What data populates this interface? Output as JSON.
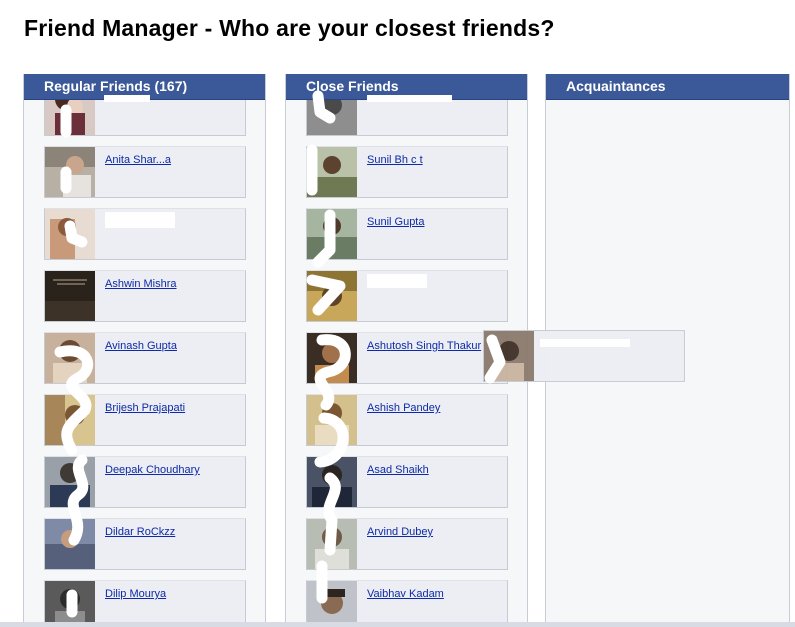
{
  "page": {
    "title": "Friend Manager - Who are your closest friends?"
  },
  "columns": {
    "regular": {
      "header": "Regular Friends (167)",
      "friends": [
        {
          "name": "",
          "photo": "person-photo"
        },
        {
          "name": "Anita Shar...a",
          "photo": "person-photo"
        },
        {
          "name": "",
          "photo": "person-photo"
        },
        {
          "name": "Ashwin Mishra",
          "photo": "dark-text-photo"
        },
        {
          "name": "Avinash Gupta",
          "photo": "person-photo"
        },
        {
          "name": "Brijesh Prajapati",
          "photo": "person-photo"
        },
        {
          "name": "Deepak Choudhary",
          "photo": "person-photo"
        },
        {
          "name": "Dildar RoCkzz",
          "photo": "person-photo"
        },
        {
          "name": "Dilip Mourya",
          "photo": "person-photo"
        }
      ]
    },
    "close": {
      "header": "Close Friends",
      "friends": [
        {
          "name": "",
          "photo": "person-photo"
        },
        {
          "name": "Sunil Bh  c  t",
          "photo": "person-photo"
        },
        {
          "name": "Sunil Gupta",
          "photo": "person-photo"
        },
        {
          "name": "",
          "photo": "person-photo"
        },
        {
          "name": "Ashutosh Singh Thakur",
          "photo": "person-photo"
        },
        {
          "name": "Ashish Pandey",
          "photo": "person-photo"
        },
        {
          "name": "Asad Shaikh",
          "photo": "person-photo"
        },
        {
          "name": "Arvind Dubey",
          "photo": "person-photo"
        },
        {
          "name": "Vaibhav Kadam",
          "photo": "person-photo"
        }
      ]
    },
    "acquaintances": {
      "header": "Acquaintances",
      "friends": []
    }
  },
  "dragging": {
    "name": "",
    "photo": "person-photo"
  },
  "colors": {
    "header_bg": "#3b5998",
    "link": "#0d2aa8",
    "card_bg": "#eceef3"
  }
}
